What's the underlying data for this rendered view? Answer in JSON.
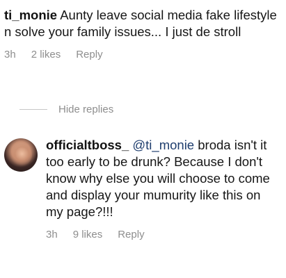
{
  "comment": {
    "username": "ti_monie",
    "text": " Aunty leave social media fake lifestyle n solve your family issues... I just de stroll",
    "time": "3h",
    "likes": "2 likes",
    "reply_label": "Reply"
  },
  "thread": {
    "hide_replies_label": "Hide replies"
  },
  "reply": {
    "username": "officialtboss_",
    "mention": "@ti_monie",
    "text": " broda isn't it too early to be drunk? Because I don't know why else you will choose to come and display your mumurity like this on my page?!!!",
    "time": "3h",
    "likes": "9 likes",
    "reply_label": "Reply"
  }
}
